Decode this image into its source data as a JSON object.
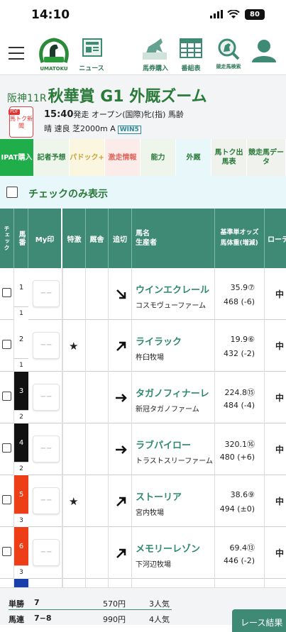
{
  "status_bar": {
    "time": "14:10",
    "battery": "80"
  },
  "header": {
    "logo_text": "UMATOKU",
    "nav": [
      {
        "label": "ニュース",
        "icon": "newspaper-icon"
      },
      {
        "label": "馬券購入",
        "icon": "horse-ticket-icon"
      },
      {
        "label": "番組表",
        "icon": "calendar-grid-icon"
      },
      {
        "label": "競走馬検索",
        "icon": "horse-search-icon"
      },
      {
        "label": "",
        "icon": "user-icon"
      }
    ]
  },
  "race": {
    "course_round": "阪神11R",
    "name": "秋華賞 G1 外厩ズーム",
    "pdf_tag": "PDF",
    "pdf_label": "馬トク新聞",
    "start_time": "15:40",
    "info1": "発走 オープン(国際)牝(指) 馬齢",
    "info2": "晴 速良 芝2000m A",
    "win5": "WIN5"
  },
  "tabs": [
    {
      "label": "IPAT購入",
      "bg": "#1fae4a",
      "fg": "#ffffff"
    },
    {
      "label": "記者予想",
      "bg": "#eef6ec",
      "fg": "#2a7a3a"
    },
    {
      "label": "パドック+",
      "bg": "#fbf6df",
      "fg": "#c9a23a"
    },
    {
      "label": "激走情報",
      "bg": "#fbebe9",
      "fg": "#e0665a"
    },
    {
      "label": "能力",
      "bg": "#eef6ec",
      "fg": "#2a7a3a"
    },
    {
      "label": "外厩",
      "bg": "#e8f7f9",
      "fg": "#2a7a3a"
    },
    {
      "label": "馬トク出馬表",
      "bg": "#f0f2ee",
      "fg": "#2a7a3a"
    },
    {
      "label": "競走馬データ",
      "bg": "#f0f2ee",
      "fg": "#2a7a3a"
    }
  ],
  "check_only_label": "チェックのみ表示",
  "table": {
    "headers": {
      "check": "チェック",
      "umaban": "馬番",
      "my_mark": "My印",
      "special": "特激",
      "stable": "厩舎",
      "oikiri": "追切",
      "name": "馬名\n生産者",
      "odds": "基準単オッズ\n馬体重(増減)",
      "rotation": "ローテ"
    },
    "rows": [
      {
        "waku": "1",
        "umaban": "1",
        "waku_bg": "#ffffff",
        "waku_fg": "#222222",
        "my_mark": "−−",
        "star": "",
        "arrow": "down-right",
        "name": "ウインエクレール",
        "breeder": "コスモヴューファーム",
        "odds": "35.9⑦",
        "weight": "468 (-6)",
        "rt": "中"
      },
      {
        "waku": "2",
        "umaban": "1",
        "waku_bg": "#ffffff",
        "waku_fg": "#222222",
        "my_mark": "−−",
        "star": "★",
        "arrow": "up-right",
        "name": "ライラック",
        "breeder": "杵臼牧場",
        "odds": "19.9⑥",
        "weight": "432 (-2)",
        "rt": "中"
      },
      {
        "waku": "3",
        "umaban": "2",
        "waku_bg": "#111111",
        "waku_fg": "#ffffff",
        "my_mark": "−−",
        "star": "",
        "arrow": "right",
        "name": "タガノフィナーレ",
        "breeder": "新冠タガノファーム",
        "odds": "224.8⑮",
        "weight": "484 (-4)",
        "rt": "中"
      },
      {
        "waku": "4",
        "umaban": "2",
        "waku_bg": "#111111",
        "waku_fg": "#ffffff",
        "my_mark": "−−",
        "star": "",
        "arrow": "right",
        "name": "ラブパイロー",
        "breeder": "トラストスリーファーム",
        "odds": "320.1⑯",
        "weight": "480 (+6)",
        "rt": "中"
      },
      {
        "waku": "5",
        "umaban": "3",
        "waku_bg": "#ee3e18",
        "waku_fg": "#ffffff",
        "my_mark": "−−",
        "star": "★",
        "arrow": "up-right",
        "name": "ストーリア",
        "breeder": "宮内牧場",
        "odds": "38.6⑨",
        "weight": "494 (±0)",
        "rt": "中"
      },
      {
        "waku": "6",
        "umaban": "3",
        "waku_bg": "#ee3e18",
        "waku_fg": "#ffffff",
        "my_mark": "−−",
        "star": "",
        "arrow": "up-right",
        "name": "メモリーレゾン",
        "breeder": "下河辺牧場",
        "odds": "69.4⑬",
        "weight": "446 (-2)",
        "rt": "中"
      },
      {
        "waku": "",
        "umaban": "",
        "waku_bg": "#1a3fa8",
        "waku_fg": "#ffffff",
        "my_mark": "",
        "star": "",
        "arrow": "",
        "name": "",
        "breeder": "",
        "odds": "",
        "weight": "",
        "rt": ""
      }
    ]
  },
  "payouts": [
    {
      "type": "単勝",
      "combo": "7",
      "amount": "570円",
      "pop": "3人気"
    },
    {
      "type": "馬連",
      "combo": "7−8",
      "amount": "990円",
      "pop": "4人気"
    }
  ],
  "result_button": "レース結果"
}
